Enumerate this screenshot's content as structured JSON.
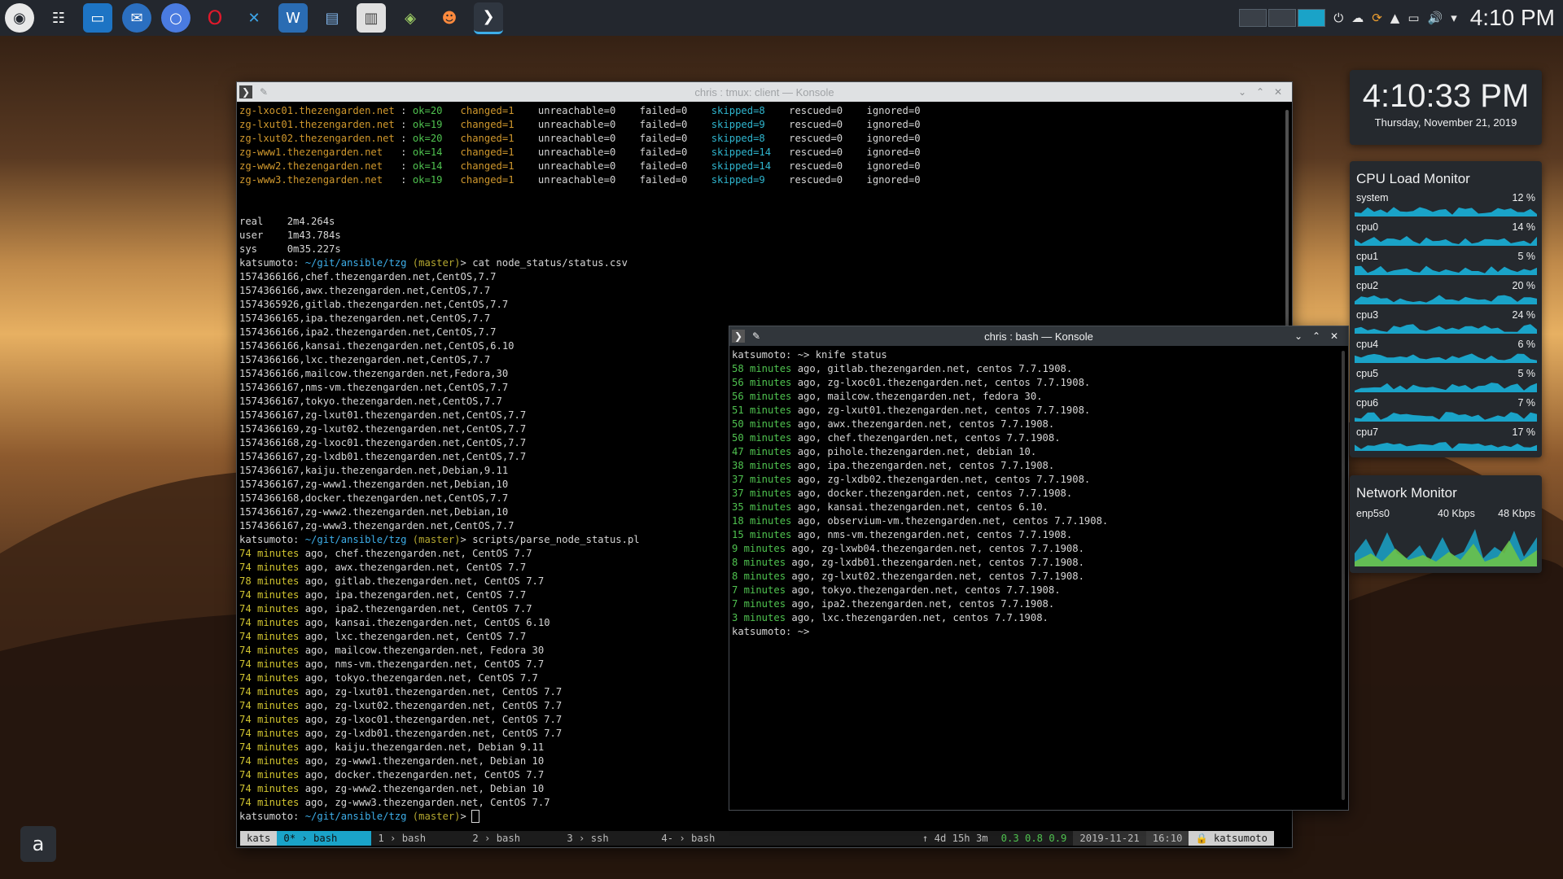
{
  "taskbar": {
    "clock": "4:10 PM",
    "launchers": [
      {
        "icon": "kde-menu-icon"
      },
      {
        "icon": "task-manager-icon"
      },
      {
        "icon": "file-manager-icon"
      },
      {
        "icon": "thunderbird-icon"
      },
      {
        "icon": "chromium-icon"
      },
      {
        "icon": "opera-icon"
      },
      {
        "icon": "vscode-icon"
      },
      {
        "icon": "libreoffice-writer-icon"
      },
      {
        "icon": "messenger-icon"
      },
      {
        "icon": "text-editor-icon"
      },
      {
        "icon": "network-tool-icon"
      },
      {
        "icon": "app-icon"
      },
      {
        "icon": "konsole-icon"
      }
    ]
  },
  "tmux_window": {
    "title": "chris : tmux: client — Konsole",
    "recap": [
      {
        "host": "zg-lxoc01.thezengarden.net ",
        "ok": "ok=20",
        "changed": "changed=1",
        "unreachable": "unreachable=0",
        "failed": "failed=0",
        "skipped": "skipped=8",
        "rescued": "rescued=0",
        "ignored": "ignored=0"
      },
      {
        "host": "zg-lxut01.thezengarden.net ",
        "ok": "ok=19",
        "changed": "changed=1",
        "unreachable": "unreachable=0",
        "failed": "failed=0",
        "skipped": "skipped=9",
        "rescued": "rescued=0",
        "ignored": "ignored=0"
      },
      {
        "host": "zg-lxut02.thezengarden.net ",
        "ok": "ok=20",
        "changed": "changed=1",
        "unreachable": "unreachable=0",
        "failed": "failed=0",
        "skipped": "skipped=8",
        "rescued": "rescued=0",
        "ignored": "ignored=0"
      },
      {
        "host": "zg-www1.thezengarden.net   ",
        "ok": "ok=14",
        "changed": "changed=1",
        "unreachable": "unreachable=0",
        "failed": "failed=0",
        "skipped": "skipped=14",
        "rescued": "rescued=0",
        "ignored": "ignored=0"
      },
      {
        "host": "zg-www2.thezengarden.net   ",
        "ok": "ok=14",
        "changed": "changed=1",
        "unreachable": "unreachable=0",
        "failed": "failed=0",
        "skipped": "skipped=14",
        "rescued": "rescued=0",
        "ignored": "ignored=0"
      },
      {
        "host": "zg-www3.thezengarden.net   ",
        "ok": "ok=19",
        "changed": "changed=1",
        "unreachable": "unreachable=0",
        "failed": "failed=0",
        "skipped": "skipped=9",
        "rescued": "rescued=0",
        "ignored": "ignored=0"
      }
    ],
    "timing": [
      "real\t2m4.264s",
      "user\t1m43.784s",
      "sys\t0m35.227s"
    ],
    "prompt_user": "katsumoto: ",
    "prompt_path": "~/git/ansible/tzg",
    "prompt_branch": " (master)",
    "cmd1": "> cat node_status/status.csv",
    "csv": [
      "1574366166,chef.thezengarden.net,CentOS,7.7",
      "1574366166,awx.thezengarden.net,CentOS,7.7",
      "1574365926,gitlab.thezengarden.net,CentOS,7.7",
      "1574366165,ipa.thezengarden.net,CentOS,7.7",
      "1574366166,ipa2.thezengarden.net,CentOS,7.7",
      "1574366166,kansai.thezengarden.net,CentOS,6.10",
      "1574366166,lxc.thezengarden.net,CentOS,7.7",
      "1574366166,mailcow.thezengarden.net,Fedora,30",
      "1574366167,nms-vm.thezengarden.net,CentOS,7.7",
      "1574366167,tokyo.thezengarden.net,CentOS,7.7",
      "1574366167,zg-lxut01.thezengarden.net,CentOS,7.7",
      "1574366169,zg-lxut02.thezengarden.net,CentOS,7.7",
      "1574366168,zg-lxoc01.thezengarden.net,CentOS,7.7",
      "1574366167,zg-lxdb01.thezengarden.net,CentOS,7.7",
      "1574366167,kaiju.thezengarden.net,Debian,9.11",
      "1574366167,zg-www1.thezengarden.net,Debian,10",
      "1574366168,docker.thezengarden.net,CentOS,7.7",
      "1574366167,zg-www2.thezengarden.net,Debian,10",
      "1574366167,zg-www3.thezengarden.net,CentOS,7.7"
    ],
    "cmd2": "> scripts/parse_node_status.pl",
    "parsed": [
      {
        "m": "74 minutes",
        "t": " ago, chef.thezengarden.net, CentOS 7.7"
      },
      {
        "m": "74 minutes",
        "t": " ago, awx.thezengarden.net, CentOS 7.7"
      },
      {
        "m": "78 minutes",
        "t": " ago, gitlab.thezengarden.net, CentOS 7.7"
      },
      {
        "m": "74 minutes",
        "t": " ago, ipa.thezengarden.net, CentOS 7.7"
      },
      {
        "m": "74 minutes",
        "t": " ago, ipa2.thezengarden.net, CentOS 7.7"
      },
      {
        "m": "74 minutes",
        "t": " ago, kansai.thezengarden.net, CentOS 6.10"
      },
      {
        "m": "74 minutes",
        "t": " ago, lxc.thezengarden.net, CentOS 7.7"
      },
      {
        "m": "74 minutes",
        "t": " ago, mailcow.thezengarden.net, Fedora 30"
      },
      {
        "m": "74 minutes",
        "t": " ago, nms-vm.thezengarden.net, CentOS 7.7"
      },
      {
        "m": "74 minutes",
        "t": " ago, tokyo.thezengarden.net, CentOS 7.7"
      },
      {
        "m": "74 minutes",
        "t": " ago, zg-lxut01.thezengarden.net, CentOS 7.7"
      },
      {
        "m": "74 minutes",
        "t": " ago, zg-lxut02.thezengarden.net, CentOS 7.7"
      },
      {
        "m": "74 minutes",
        "t": " ago, zg-lxoc01.thezengarden.net, CentOS 7.7"
      },
      {
        "m": "74 minutes",
        "t": " ago, zg-lxdb01.thezengarden.net, CentOS 7.7"
      },
      {
        "m": "74 minutes",
        "t": " ago, kaiju.thezengarden.net, Debian 9.11"
      },
      {
        "m": "74 minutes",
        "t": " ago, zg-www1.thezengarden.net, Debian 10"
      },
      {
        "m": "74 minutes",
        "t": " ago, docker.thezengarden.net, CentOS 7.7"
      },
      {
        "m": "74 minutes",
        "t": " ago, zg-www2.thezengarden.net, Debian 10"
      },
      {
        "m": "74 minutes",
        "t": " ago, zg-www3.thezengarden.net, CentOS 7.7"
      }
    ],
    "final_prompt_tail": "> ",
    "tmux_status": {
      "session": "kats",
      "windows": [
        {
          "idx": "0*",
          "name": "bash"
        },
        {
          "idx": "1",
          "name": "bash"
        },
        {
          "idx": "2",
          "name": "bash"
        },
        {
          "idx": "3",
          "name": "ssh"
        },
        {
          "idx": "4-",
          "name": "bash"
        }
      ],
      "uptime": "↑  4d 15h 3m",
      "load": "0.3 0.8 0.9",
      "date": "2019-11-21",
      "time": "16:10",
      "user": "🔒 katsumoto"
    }
  },
  "bash_window": {
    "title": "chris : bash — Konsole",
    "prompt": "katsumoto: ~> knife status",
    "lines": [
      {
        "m": "58 minutes",
        "t": " ago, gitlab.thezengarden.net, centos 7.7.1908."
      },
      {
        "m": "56 minutes",
        "t": " ago, zg-lxoc01.thezengarden.net, centos 7.7.1908."
      },
      {
        "m": "56 minutes",
        "t": " ago, mailcow.thezengarden.net, fedora 30."
      },
      {
        "m": "51 minutes",
        "t": " ago, zg-lxut01.thezengarden.net, centos 7.7.1908."
      },
      {
        "m": "50 minutes",
        "t": " ago, awx.thezengarden.net, centos 7.7.1908."
      },
      {
        "m": "50 minutes",
        "t": " ago, chef.thezengarden.net, centos 7.7.1908."
      },
      {
        "m": "47 minutes",
        "t": " ago, pihole.thezengarden.net, debian 10."
      },
      {
        "m": "38 minutes",
        "t": " ago, ipa.thezengarden.net, centos 7.7.1908."
      },
      {
        "m": "37 minutes",
        "t": " ago, zg-lxdb02.thezengarden.net, centos 7.7.1908."
      },
      {
        "m": "37 minutes",
        "t": " ago, docker.thezengarden.net, centos 7.7.1908."
      },
      {
        "m": "35 minutes",
        "t": " ago, kansai.thezengarden.net, centos 6.10."
      },
      {
        "m": "18 minutes",
        "t": " ago, observium-vm.thezengarden.net, centos 7.7.1908."
      },
      {
        "m": "15 minutes",
        "t": " ago, nms-vm.thezengarden.net, centos 7.7.1908."
      },
      {
        "m": "9 minutes",
        "t": " ago, zg-lxwb04.thezengarden.net, centos 7.7.1908."
      },
      {
        "m": "8 minutes",
        "t": " ago, zg-lxdb01.thezengarden.net, centos 7.7.1908."
      },
      {
        "m": "8 minutes",
        "t": " ago, zg-lxut02.thezengarden.net, centos 7.7.1908."
      },
      {
        "m": "7 minutes",
        "t": " ago, tokyo.thezengarden.net, centos 7.7.1908."
      },
      {
        "m": "7 minutes",
        "t": " ago, ipa2.thezengarden.net, centos 7.7.1908."
      },
      {
        "m": "3 minutes",
        "t": " ago, lxc.thezengarden.net, centos 7.7.1908."
      }
    ],
    "end_prompt": "katsumoto: ~>"
  },
  "clock_widget": {
    "time": "4:10:33 PM",
    "date": "Thursday, November 21, 2019"
  },
  "cpu_monitor": {
    "title": "CPU Load Monitor",
    "rows": [
      {
        "name": "system",
        "value": "12 %"
      },
      {
        "name": "cpu0",
        "value": "14 %"
      },
      {
        "name": "cpu1",
        "value": "5 %"
      },
      {
        "name": "cpu2",
        "value": "20 %"
      },
      {
        "name": "cpu3",
        "value": "24 %"
      },
      {
        "name": "cpu4",
        "value": "6 %"
      },
      {
        "name": "cpu5",
        "value": "5 %"
      },
      {
        "name": "cpu6",
        "value": "7 %"
      },
      {
        "name": "cpu7",
        "value": "17 %"
      }
    ]
  },
  "network_monitor": {
    "title": "Network Monitor",
    "iface": "enp5s0",
    "down": "40 Kbps",
    "up": "48 Kbps"
  },
  "launcher_button": {
    "label": "a"
  },
  "colors": {
    "accent": "#3daee9",
    "yellow": "#d2c530",
    "green": "#4fc24f",
    "cyan": "#2fb6cf",
    "orange": "#d0982d"
  }
}
